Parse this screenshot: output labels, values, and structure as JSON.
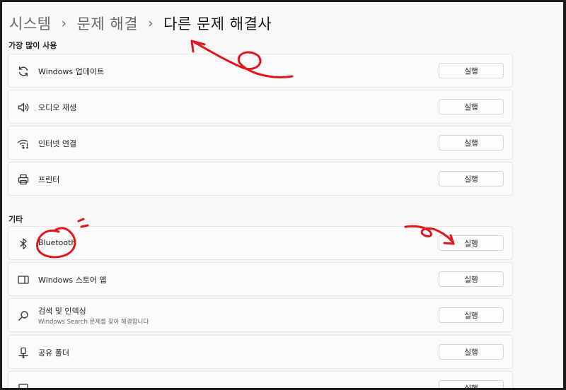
{
  "breadcrumb": {
    "items": [
      "시스템",
      "문제 해결",
      "다른 문제 해결사"
    ],
    "separator": "›"
  },
  "sections": [
    {
      "title": "가장 많이 사용",
      "items": [
        {
          "icon": "refresh-icon",
          "label": "Windows 업데이트",
          "button": "실행"
        },
        {
          "icon": "speaker-icon",
          "label": "오디오 재생",
          "button": "실행"
        },
        {
          "icon": "wifi-icon",
          "label": "인터넷 연결",
          "button": "실행"
        },
        {
          "icon": "printer-icon",
          "label": "프린터",
          "button": "실행"
        }
      ]
    },
    {
      "title": "기타",
      "items": [
        {
          "icon": "bluetooth-icon",
          "label": "Bluetooth",
          "button": "실행"
        },
        {
          "icon": "store-app-icon",
          "label": "Windows 스토어 앱",
          "button": "실행"
        },
        {
          "icon": "search-icon",
          "label": "검색 및 인덱싱",
          "description": "Windows Search 문제를 찾아 해결합니다",
          "button": "실행"
        },
        {
          "icon": "shared-folder-icon",
          "label": "공유 폴더",
          "button": "실행"
        },
        {
          "icon": "generic-icon",
          "label": "",
          "button": "실행"
        }
      ]
    }
  ],
  "colors": {
    "annotation": "#e0161b",
    "background": "#f9f7f8",
    "card": "#fbfbfb"
  }
}
